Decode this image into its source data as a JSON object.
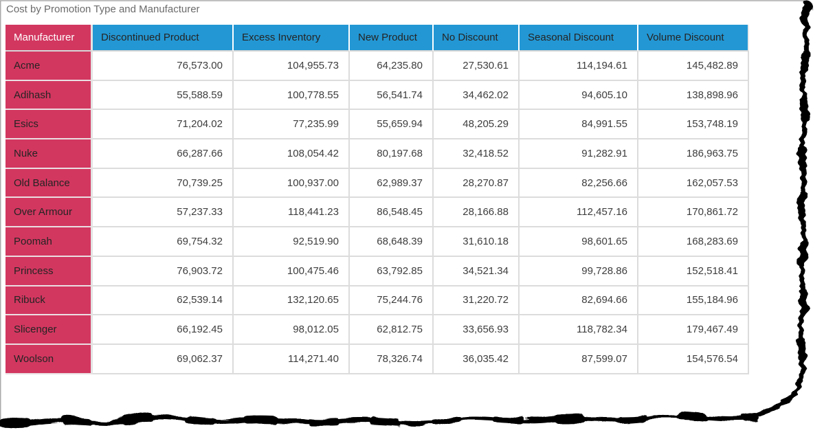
{
  "chart_data": {
    "type": "table",
    "title": "Cost by Promotion Type and Manufacturer",
    "columns": [
      "Manufacturer",
      "Discontinued Product",
      "Excess Inventory",
      "New Product",
      "No Discount",
      "Seasonal Discount",
      "Volume Discount"
    ],
    "rows": [
      {
        "manufacturer": "Acme",
        "values": [
          "76,573.00",
          "104,955.73",
          "64,235.80",
          "27,530.61",
          "114,194.61",
          "145,482.89"
        ]
      },
      {
        "manufacturer": "Adihash",
        "values": [
          "55,588.59",
          "100,778.55",
          "56,541.74",
          "34,462.02",
          "94,605.10",
          "138,898.96"
        ]
      },
      {
        "manufacturer": "Esics",
        "values": [
          "71,204.02",
          "77,235.99",
          "55,659.94",
          "48,205.29",
          "84,991.55",
          "153,748.19"
        ]
      },
      {
        "manufacturer": "Nuke",
        "values": [
          "66,287.66",
          "108,054.42",
          "80,197.68",
          "32,418.52",
          "91,282.91",
          "186,963.75"
        ]
      },
      {
        "manufacturer": "Old Balance",
        "values": [
          "70,739.25",
          "100,937.00",
          "62,989.37",
          "28,270.87",
          "82,256.66",
          "162,057.53"
        ]
      },
      {
        "manufacturer": "Over Armour",
        "values": [
          "57,237.33",
          "118,441.23",
          "86,548.45",
          "28,166.88",
          "112,457.16",
          "170,861.72"
        ]
      },
      {
        "manufacturer": "Poomah",
        "values": [
          "69,754.32",
          "92,519.90",
          "68,648.39",
          "31,610.18",
          "98,601.65",
          "168,283.69"
        ]
      },
      {
        "manufacturer": "Princess",
        "values": [
          "76,903.72",
          "100,475.46",
          "63,792.85",
          "34,521.34",
          "99,728.86",
          "152,518.41"
        ]
      },
      {
        "manufacturer": "Ribuck",
        "values": [
          "62,539.14",
          "132,120.65",
          "75,244.76",
          "31,220.72",
          "82,694.66",
          "155,184.96"
        ]
      },
      {
        "manufacturer": "Slicenger",
        "values": [
          "66,192.45",
          "98,012.05",
          "62,812.75",
          "33,656.93",
          "118,782.34",
          "179,467.49"
        ]
      },
      {
        "manufacturer": "Woolson",
        "values": [
          "69,062.37",
          "114,271.40",
          "78,326.74",
          "36,035.42",
          "87,599.07",
          "154,576.54"
        ]
      }
    ],
    "layout_hints": {
      "legend": "none",
      "grid": "on",
      "value_alignment": "right"
    }
  },
  "colors": {
    "column_header_bg": "#2397d4",
    "row_header_bg": "#d23760",
    "header_text": "#252423",
    "corner_header_text": "#ffffff",
    "cell_text": "#3d3d3d",
    "title_text": "#6b6b6b",
    "grid_line": "#dcdcdc",
    "torn_edge": "#000000",
    "border_line": "#ababab"
  }
}
